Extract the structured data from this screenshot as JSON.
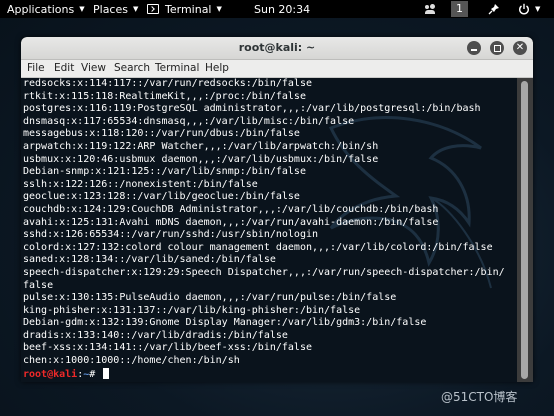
{
  "topbar": {
    "applications_label": "Applications",
    "places_label": "Places",
    "terminal_label": "Terminal",
    "clock": "Sun 20:34",
    "workspace_number": "1"
  },
  "window": {
    "title": "root@kali: ~",
    "menu": [
      "File",
      "Edit",
      "View",
      "Search",
      "Terminal",
      "Help"
    ]
  },
  "terminal": {
    "lines": [
      "redsocks:x:114:117::/var/run/redsocks:/bin/false",
      "rtkit:x:115:118:RealtimeKit,,,:/proc:/bin/false",
      "postgres:x:116:119:PostgreSQL administrator,,,:/var/lib/postgresql:/bin/bash",
      "dnsmasq:x:117:65534:dnsmasq,,,:/var/lib/misc:/bin/false",
      "messagebus:x:118:120::/var/run/dbus:/bin/false",
      "arpwatch:x:119:122:ARP Watcher,,,:/var/lib/arpwatch:/bin/sh",
      "usbmux:x:120:46:usbmux daemon,,,:/var/lib/usbmux:/bin/false",
      "Debian-snmp:x:121:125::/var/lib/snmp:/bin/false",
      "sslh:x:122:126::/nonexistent:/bin/false",
      "geoclue:x:123:128::/var/lib/geoclue:/bin/false",
      "couchdb:x:124:129:CouchDB Administrator,,,:/var/lib/couchdb:/bin/bash",
      "avahi:x:125:131:Avahi mDNS daemon,,,:/var/run/avahi-daemon:/bin/false",
      "sshd:x:126:65534::/var/run/sshd:/usr/sbin/nologin",
      "colord:x:127:132:colord colour management daemon,,,:/var/lib/colord:/bin/false",
      "saned:x:128:134::/var/lib/saned:/bin/false",
      "speech-dispatcher:x:129:29:Speech Dispatcher,,,:/var/run/speech-dispatcher:/bin/",
      "false",
      "pulse:x:130:135:PulseAudio daemon,,,:/var/run/pulse:/bin/false",
      "king-phisher:x:131:137::/var/lib/king-phisher:/bin/false",
      "Debian-gdm:x:132:139:Gnome Display Manager:/var/lib/gdm3:/bin/false",
      "dradis:x:133:140::/var/lib/dradis:/bin/false",
      "beef-xss:x:134:141::/var/lib/beef-xss:/bin/false",
      "chen:x:1000:1000::/home/chen:/bin/sh"
    ],
    "prompt_user": "root@kali",
    "prompt_sep": ":",
    "prompt_path": "~",
    "prompt_sign": "# "
  },
  "watermark": "@51CTO博客",
  "colors": {
    "prompt_user": "#ef2929",
    "prompt_path": "#5c8fd6",
    "terminal_bg": "#08121b"
  }
}
